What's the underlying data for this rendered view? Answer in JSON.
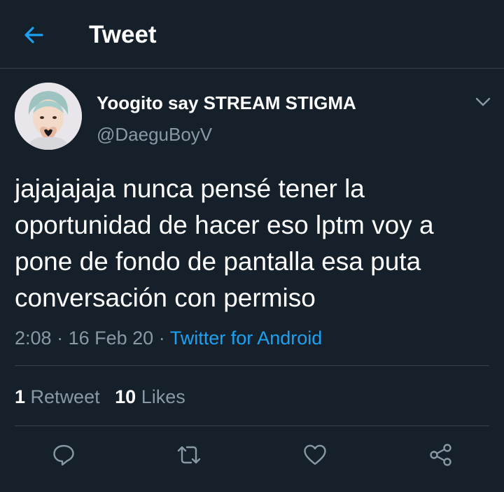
{
  "header": {
    "title": "Tweet",
    "back_icon": "arrow-left-icon"
  },
  "tweet": {
    "author": {
      "display_name": "Yoogito say STREAM STIGMA",
      "handle": "@DaeguBoyV"
    },
    "text_lines": [
      "jajajajaja nunca pensé tener la",
      "oportunidad de hacer eso lptm voy a",
      "pone de fondo de pantalla esa puta",
      "conversación con permiso"
    ],
    "time": "2:08",
    "separator": "·",
    "date": "16 Feb 20",
    "source": "Twitter for Android",
    "stats": {
      "retweets_count": "1",
      "retweets_label": "Retweet",
      "likes_count": "10",
      "likes_label": "Likes"
    }
  },
  "actions": [
    "reply-icon",
    "retweet-icon",
    "like-icon",
    "share-icon"
  ],
  "colors": {
    "background": "#15202b",
    "accent": "#1da1f2",
    "secondary_text": "#8899a6",
    "divider": "#38444d"
  }
}
